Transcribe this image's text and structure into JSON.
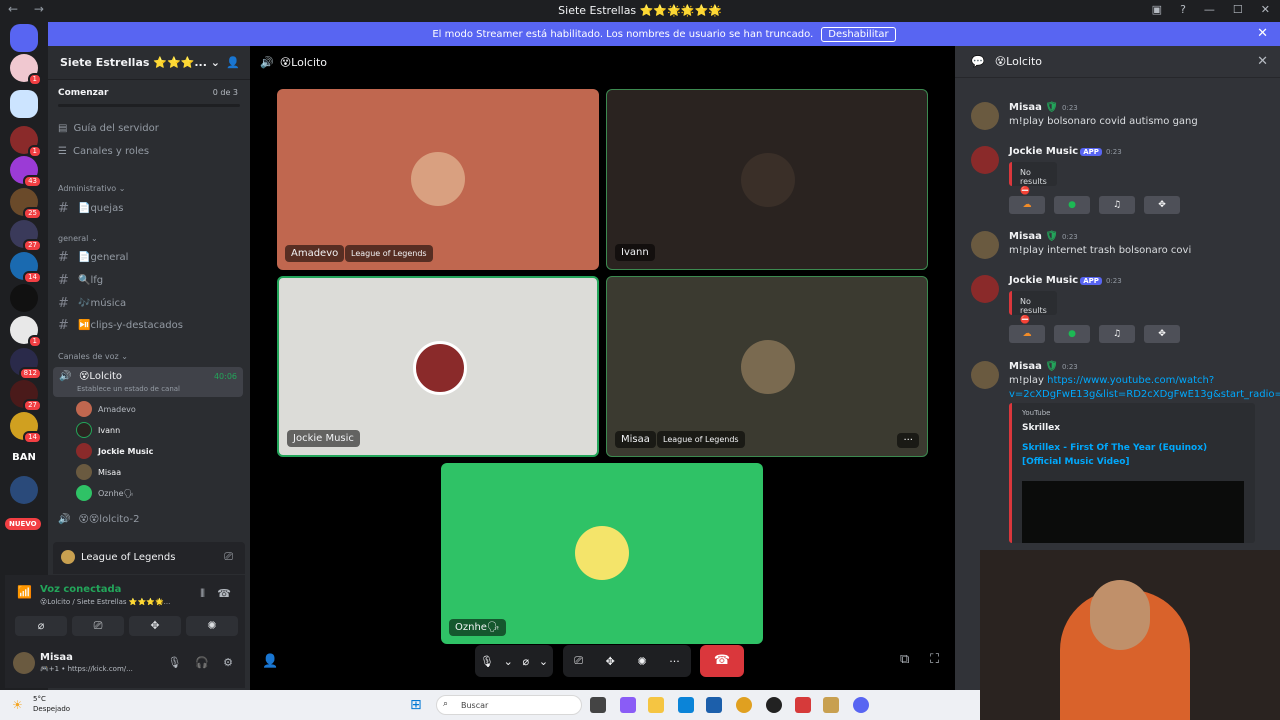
{
  "window": {
    "title": "Siete Estrellas ⭐⭐🌟🌟⭐🌟",
    "back": "←",
    "forward": "→"
  },
  "banner": {
    "text": "El modo Streamer está habilitado. Los nombres de usuario se han truncado.",
    "button": "Deshabilitar"
  },
  "servers": {
    "badges": [
      "1",
      "1",
      "43",
      "25",
      "27",
      "14",
      "1",
      "812",
      "27",
      "14",
      "5"
    ],
    "ban_label": "BAN",
    "new_label": "NUEVO"
  },
  "guild": {
    "name": "Siete Estrellas ⭐⭐⭐...",
    "onboarding": {
      "label": "Comenzar",
      "count": "0 de 3",
      "progress": 0
    },
    "nav": [
      "Guía del servidor",
      "Canales y roles"
    ],
    "categories": {
      "admin": "Administrativo",
      "general": "general",
      "voice": "Canales de voz"
    },
    "admin_channels": [
      "📄quejas"
    ],
    "text_channels": [
      "📄general",
      "🔍lfg",
      "🎶música",
      "⏯️clips-y-destacados"
    ],
    "voice_channel": {
      "name": "😵Lolcito",
      "status_hint": "Establece un estado de canal",
      "duration": "40:06"
    },
    "voice_users": [
      "Amadevo",
      "Ivann",
      "Jockie Music",
      "Misaa",
      "Oznhe🗣"
    ],
    "other_voice": "😵😵lolcito-2"
  },
  "activity": {
    "game": "League of Legends"
  },
  "voice_panel": {
    "status": "Voz conectada",
    "route": "😵Lolcito / Siete Estrellas ⭐⭐⭐🌟..."
  },
  "user": {
    "name": "Misaa",
    "status": "🎮+1 • https://kick.com/..."
  },
  "stage": {
    "channel": "😵Lolcito",
    "tiles": [
      {
        "name": "Amadevo",
        "activity": "League of Legends",
        "bg": "#c0674f"
      },
      {
        "name": "Ivann",
        "bg": "#2a2320"
      },
      {
        "name": "Jockie Music",
        "bg": "#dcdcd8"
      },
      {
        "name": "Misaa",
        "activity": "League of Legends",
        "bg": "#3b3a30"
      },
      {
        "name": "Oznhe🗣",
        "bg": "#2fc266"
      }
    ],
    "more": "···"
  },
  "chat": {
    "channel": "😵Lolcito",
    "messages": [
      {
        "author": "Misaa",
        "time": "0:23",
        "text": "m!play bolsonaro covid autismo gang"
      },
      {
        "author": "Jockie Music",
        "app": "APP",
        "time": "0:23",
        "embed": "No results ⛔"
      },
      {
        "author": "Misaa",
        "time": "0:23",
        "text": "m!play internet trash bolsonaro covi"
      },
      {
        "author": "Jockie Music",
        "app": "APP",
        "time": "0:23",
        "embed": "No results ⛔"
      },
      {
        "author": "Misaa",
        "time": "0:23",
        "text_prefix": "m!play ",
        "link": "https://www.youtube.com/watch?",
        "link2": "v=2cXDgFwE13g&list=RD2cXDgFwE13g&start_radio=1"
      }
    ],
    "youtube": {
      "provider": "YouTube",
      "author": "Skrillex",
      "title": "Skrillex - First Of The Year (Equinox) [Official Music Video]"
    }
  },
  "taskbar": {
    "temp": "5°C",
    "weather": "Despejado",
    "search": "Buscar"
  }
}
